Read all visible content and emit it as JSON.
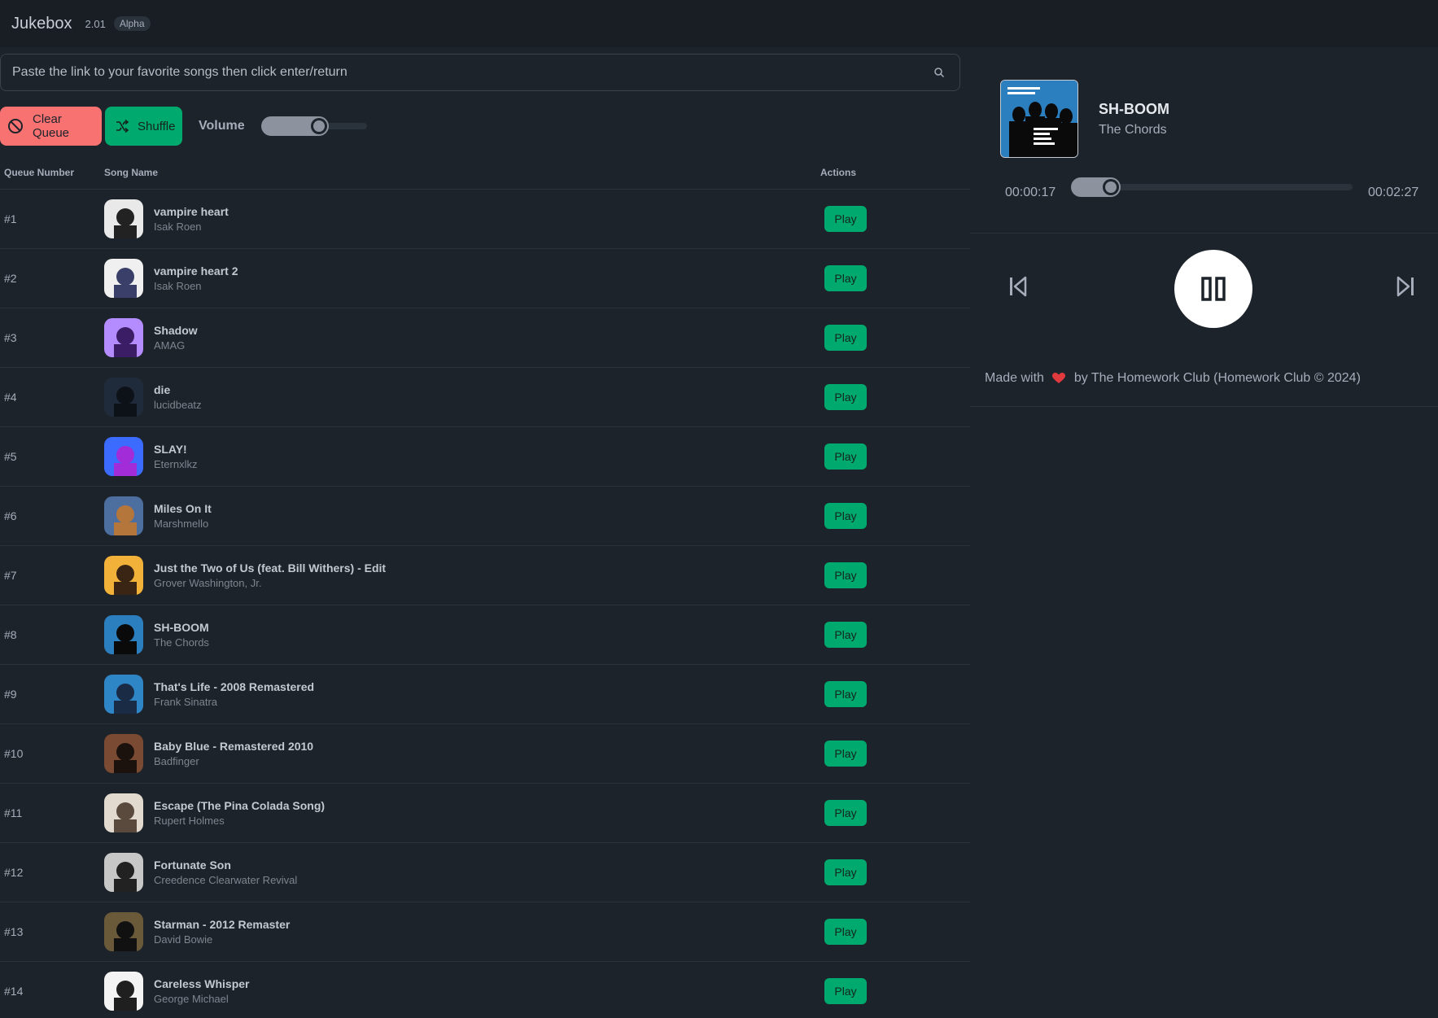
{
  "header": {
    "title": "Jukebox",
    "version": "2.01",
    "badge": "Alpha"
  },
  "search": {
    "placeholder": "Paste the link to your favorite songs then click enter/return",
    "value": ""
  },
  "controls": {
    "clear_label": "Clear Queue",
    "shuffle_label": "Shuffle",
    "volume_label": "Volume",
    "volume_percent": 55
  },
  "table": {
    "headers": [
      "Queue Number",
      "Song Name",
      "Actions"
    ],
    "play_label": "Play",
    "rows": [
      {
        "num": "#1",
        "title": "vampire heart",
        "artist": "Isak Roen",
        "art": [
          "#e9e9e9",
          "#222222"
        ]
      },
      {
        "num": "#2",
        "title": "vampire heart 2",
        "artist": "Isak Roen",
        "art": [
          "#f0f0f0",
          "#3a3f6a"
        ]
      },
      {
        "num": "#3",
        "title": "Shadow",
        "artist": "AMAG",
        "art": [
          "#b58cff",
          "#3b1d66"
        ]
      },
      {
        "num": "#4",
        "title": "die",
        "artist": "lucidbeatz",
        "art": [
          "#1f2a3a",
          "#0d1118"
        ]
      },
      {
        "num": "#5",
        "title": "SLAY!",
        "artist": "Eternxlkz",
        "art": [
          "#3b6cff",
          "#a12cd8"
        ]
      },
      {
        "num": "#6",
        "title": "Miles On It",
        "artist": "Marshmello",
        "art": [
          "#4d6fa0",
          "#b5763c"
        ]
      },
      {
        "num": "#7",
        "title": "Just the Two of Us (feat. Bill Withers) - Edit",
        "artist": "Grover Washington, Jr.",
        "art": [
          "#f2b23a",
          "#3a2413"
        ]
      },
      {
        "num": "#8",
        "title": "SH-BOOM",
        "artist": "The Chords",
        "art": [
          "#2c7fbf",
          "#0a0a0a"
        ]
      },
      {
        "num": "#9",
        "title": "That's Life - 2008 Remastered",
        "artist": "Frank Sinatra",
        "art": [
          "#2f86c7",
          "#1a2c45"
        ]
      },
      {
        "num": "#10",
        "title": "Baby Blue - Remastered 2010",
        "artist": "Badfinger",
        "art": [
          "#7a4a32",
          "#1b120e"
        ]
      },
      {
        "num": "#11",
        "title": "Escape (The Pina Colada Song)",
        "artist": "Rupert Holmes",
        "art": [
          "#e2d9cf",
          "#5a4a3e"
        ]
      },
      {
        "num": "#12",
        "title": "Fortunate Son",
        "artist": "Creedence Clearwater Revival",
        "art": [
          "#c7c7c7",
          "#222222"
        ]
      },
      {
        "num": "#13",
        "title": "Starman - 2012 Remaster",
        "artist": "David Bowie",
        "art": [
          "#6b5a3a",
          "#111111"
        ]
      },
      {
        "num": "#14",
        "title": "Careless Whisper",
        "artist": "George Michael",
        "art": [
          "#f3f3f3",
          "#1f1f1f"
        ]
      }
    ]
  },
  "now_playing": {
    "title": "SH-BOOM",
    "artist": "The Chords",
    "elapsed": "00:00:17",
    "duration": "00:02:27",
    "progress_percent": 12
  },
  "footer": {
    "prefix": "Made with",
    "suffix": "by The Homework Club (Homework Club © 2024)"
  },
  "colors": {
    "background": "#1d232a",
    "topbar": "#191e24",
    "accent_green": "#00a96e",
    "accent_red": "#f87272",
    "heart": "#e0393e"
  },
  "icons": {
    "search": "search-icon",
    "clear": "ban-icon",
    "shuffle": "shuffle-icon",
    "prev": "skip-back-icon",
    "pause": "pause-icon",
    "next": "skip-forward-icon",
    "heart": "heart-icon"
  }
}
